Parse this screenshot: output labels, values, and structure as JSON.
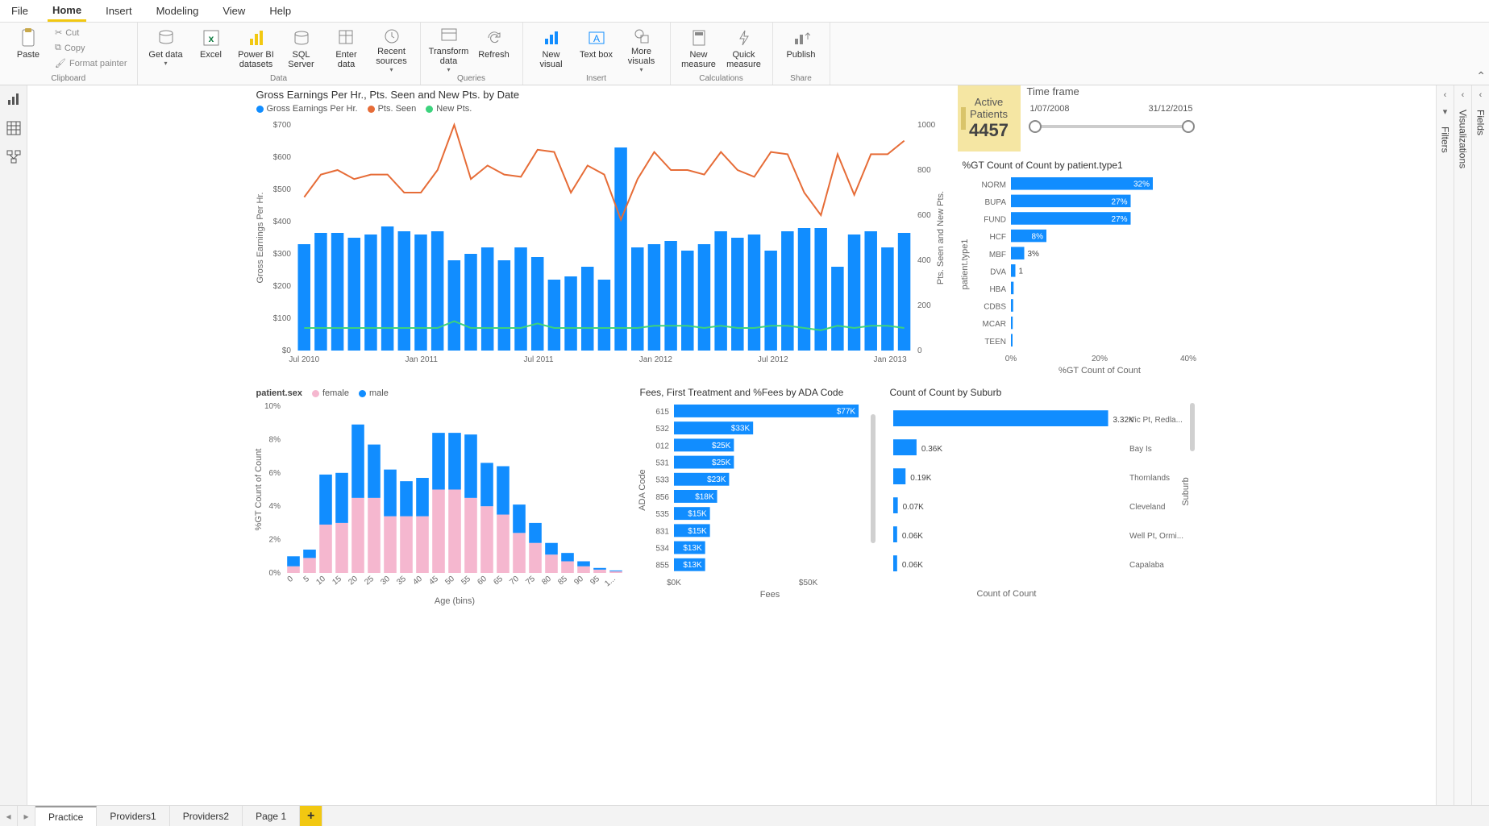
{
  "menu": {
    "items": [
      "File",
      "Home",
      "Insert",
      "Modeling",
      "View",
      "Help"
    ],
    "active": "Home"
  },
  "ribbon": {
    "clipboard": {
      "paste": "Paste",
      "cut": "Cut",
      "copy": "Copy",
      "format_painter": "Format painter",
      "label": "Clipboard"
    },
    "data": {
      "get_data": "Get data",
      "excel": "Excel",
      "pbi_datasets": "Power BI datasets",
      "sql": "SQL Server",
      "enter": "Enter data",
      "recent": "Recent sources",
      "label": "Data"
    },
    "queries": {
      "transform": "Transform data",
      "refresh": "Refresh",
      "label": "Queries"
    },
    "insert": {
      "new_visual": "New visual",
      "text_box": "Text box",
      "more_visuals": "More visuals",
      "label": "Insert"
    },
    "calc": {
      "new_measure": "New measure",
      "quick_measure": "Quick measure",
      "label": "Calculations"
    },
    "share": {
      "publish": "Publish",
      "label": "Share"
    }
  },
  "right_panes": {
    "filters": "Filters",
    "visualizations": "Visualizations",
    "fields": "Fields"
  },
  "tabs": {
    "items": [
      "Practice",
      "Providers1",
      "Providers2",
      "Page 1"
    ],
    "active": "Practice",
    "add": "+"
  },
  "kpi": {
    "title": "Active Patients",
    "value": "4457"
  },
  "slicer": {
    "title": "Time frame",
    "start": "1/07/2008",
    "end": "31/12/2015"
  },
  "chart_data": [
    {
      "id": "combo",
      "type": "bar-line-combo",
      "title": "Gross Earnings Per Hr., Pts. Seen and New Pts. by Date",
      "legend": [
        {
          "name": "Gross Earnings Per Hr.",
          "color": "#118dff"
        },
        {
          "name": "Pts. Seen",
          "color": "#e66c37"
        },
        {
          "name": "New Pts.",
          "color": "#3cd37d"
        }
      ],
      "ylabel_left": "Gross Earnings Per Hr.",
      "ylabel_right": "Pts. Seen and New Pts.",
      "yticks_left": [
        "$0",
        "$100",
        "$200",
        "$300",
        "$400",
        "$500",
        "$600",
        "$700"
      ],
      "yticks_right": [
        "0",
        "200",
        "400",
        "600",
        "800",
        "1000"
      ],
      "xticks": [
        "Jul 2010",
        "Jan 2011",
        "Jul 2011",
        "Jan 2012",
        "Jul 2012",
        "Jan 2013"
      ],
      "bars": [
        330,
        365,
        365,
        350,
        360,
        385,
        370,
        360,
        370,
        280,
        300,
        320,
        280,
        320,
        290,
        220,
        230,
        260,
        220,
        630,
        320,
        330,
        340,
        310,
        330,
        370,
        350,
        360,
        310,
        370,
        380,
        380,
        260,
        360,
        370,
        320,
        365
      ],
      "line_pts_seen": [
        680,
        780,
        800,
        760,
        780,
        780,
        700,
        700,
        800,
        1000,
        760,
        820,
        780,
        770,
        890,
        880,
        700,
        820,
        780,
        580,
        760,
        880,
        800,
        800,
        780,
        880,
        800,
        770,
        880,
        870,
        700,
        600,
        870,
        690,
        870,
        870,
        930
      ],
      "line_new_pts": [
        100,
        100,
        100,
        100,
        100,
        100,
        100,
        100,
        100,
        130,
        100,
        100,
        100,
        100,
        120,
        100,
        100,
        100,
        100,
        100,
        100,
        110,
        110,
        110,
        100,
        110,
        100,
        100,
        110,
        110,
        100,
        90,
        110,
        100,
        110,
        110,
        100
      ],
      "ylim_left": [
        0,
        700
      ],
      "ylim_right": [
        0,
        1000
      ]
    },
    {
      "id": "age_sex",
      "type": "stacked-bar",
      "title_prefix": "patient.sex",
      "legend": [
        {
          "name": "female",
          "color": "#f5b7cf"
        },
        {
          "name": "male",
          "color": "#118dff"
        }
      ],
      "xlabel": "Age (bins)",
      "ylabel": "%GT Count of Count",
      "categories": [
        "0",
        "5",
        "10",
        "15",
        "20",
        "25",
        "30",
        "35",
        "40",
        "45",
        "50",
        "55",
        "60",
        "65",
        "70",
        "75",
        "80",
        "85",
        "90",
        "95",
        "1..."
      ],
      "yticks": [
        "0%",
        "2%",
        "4%",
        "6%",
        "8%",
        "10%"
      ],
      "series": [
        {
          "name": "female",
          "values": [
            0.4,
            0.9,
            2.9,
            3.0,
            4.5,
            4.5,
            3.4,
            3.4,
            3.4,
            5.0,
            5.0,
            4.5,
            4.0,
            3.5,
            2.4,
            1.8,
            1.1,
            0.7,
            0.4,
            0.2,
            0.1
          ]
        },
        {
          "name": "male",
          "values": [
            0.6,
            0.5,
            3.0,
            3.0,
            4.4,
            3.2,
            2.8,
            2.1,
            2.3,
            3.4,
            3.4,
            3.8,
            2.6,
            2.9,
            1.7,
            1.2,
            0.7,
            0.5,
            0.3,
            0.1,
            0.05
          ]
        }
      ],
      "ylim": [
        0,
        10
      ]
    },
    {
      "id": "ada",
      "type": "hbar",
      "title": "Fees, First Treatment and %Fees by ADA Code",
      "ylabel": "ADA Code",
      "xlabel": "Fees",
      "xticks": [
        "$0K",
        "$50K"
      ],
      "categories": [
        "615",
        "532",
        "012",
        "531",
        "533",
        "856",
        "535",
        "831",
        "534",
        "855"
      ],
      "values": [
        77,
        33,
        25,
        25,
        23,
        18,
        15,
        15,
        13,
        13
      ],
      "value_labels": [
        "$77K",
        "$33K",
        "$25K",
        "$25K",
        "$23K",
        "$18K",
        "$15K",
        "$15K",
        "$13K",
        "$13K"
      ],
      "xlim": [
        0,
        80
      ]
    },
    {
      "id": "suburb",
      "type": "hbar",
      "title": "Count of Count by Suburb",
      "xlabel": "Count of Count",
      "ylabel_right": "Suburb",
      "categories": [
        "Vic Pt, Redla...",
        "Bay Is",
        "Thornlands",
        "Cleveland",
        "Well Pt, Ormi...",
        "Capalaba"
      ],
      "values": [
        3.32,
        0.36,
        0.19,
        0.07,
        0.06,
        0.06
      ],
      "value_labels": [
        "3.32K",
        "0.36K",
        "0.19K",
        "0.07K",
        "0.06K",
        "0.06K"
      ],
      "xlim": [
        0,
        3.5
      ]
    },
    {
      "id": "ptype",
      "type": "hbar",
      "title": "%GT Count of Count by patient.type1",
      "ylabel": "patient.type1",
      "xlabel": "%GT Count of Count",
      "xticks": [
        "0%",
        "20%",
        "40%"
      ],
      "categories": [
        "NORM",
        "BUPA",
        "FUND",
        "HCF",
        "MBF",
        "DVA",
        "HBA",
        "CDBS",
        "MCAR",
        "TEEN"
      ],
      "values": [
        32,
        27,
        27,
        8,
        3,
        1,
        0.6,
        0.5,
        0.4,
        0.3
      ],
      "value_labels": [
        "32%",
        "27%",
        "27%",
        "8%",
        "3%",
        "1",
        "",
        "",
        "",
        ""
      ],
      "xlim": [
        0,
        40
      ]
    }
  ]
}
